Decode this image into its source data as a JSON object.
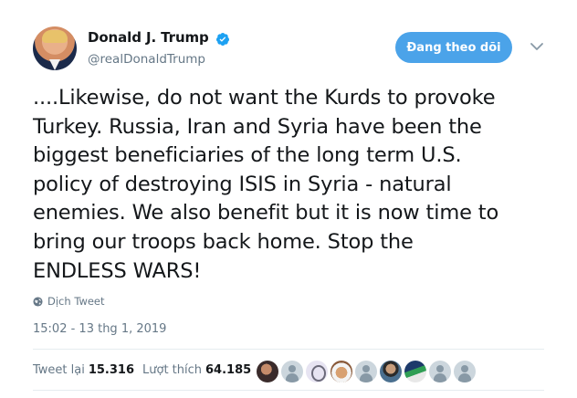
{
  "author": {
    "name": "Donald J. Trump",
    "handle": "@realDonaldTrump",
    "verified": true
  },
  "follow_button": {
    "label": "Đang theo dõi"
  },
  "tweet": {
    "text": "....Likewise, do not want the Kurds to provoke\nTurkey. Russia, Iran and Syria have been the\nbiggest beneficiaries of the long term U.S.\npolicy of destroying ISIS in Syria - natural\nenemies. We also benefit but it is now time to\nbring our troops back home. Stop the\nENDLESS WARS!",
    "translate_label": "Dịch Tweet",
    "timestamp": "15:02 - 13 thg 1, 2019"
  },
  "stats": {
    "retweets_label": "Tweet lại",
    "retweets_count": "15.316",
    "likes_label": "Lượt thích",
    "likes_count": "64.185"
  },
  "colors": {
    "accent": "#4ba3e9",
    "verified": "#1da1f2",
    "secondary_text": "#657786"
  },
  "icons": [
    "verified-badge-icon",
    "chevron-down-icon",
    "globe-icon"
  ]
}
